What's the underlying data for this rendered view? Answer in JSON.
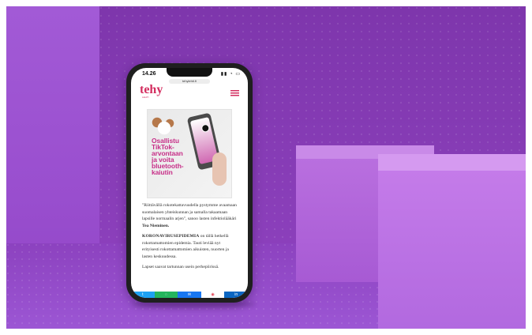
{
  "status_bar": {
    "time": "14.26",
    "url": "tehylehti.fi"
  },
  "site": {
    "logo_main": "tehy",
    "logo_sub": "LEHTI"
  },
  "ad": {
    "line1": "Osallistu",
    "line2": "TikTok-",
    "line3": "arvontaan",
    "line4": "ja voita",
    "line5": "bluetooth-",
    "line6": "kaiutin"
  },
  "article": {
    "paragraph1_text": "\"Riittävällä rokotekattavuudella pystymme avaamaan suomalaisen yhteiskunnan ja samalla takaamaan lapsille normaalin arjen\", sanoo lasten infektiolääkäri",
    "paragraph1_name": "Tea Nieminen.",
    "paragraph2_lead": "KORONAVIRUSEPIDEMIA",
    "paragraph2_text": " on tällä hetkellä rokottamattomien epidemia. Tauti leviää nyt erityisesti rokottamattomien aikuisten, nuorten ja lasten keskuudessa.",
    "paragraph3_text": "Lapset saavat tartunnan usein perhepiirissä."
  },
  "share_bar": {
    "items": [
      {
        "label": "t",
        "icon": "twitter-icon"
      },
      {
        "label": "◌",
        "icon": "whatsapp-icon"
      },
      {
        "label": "✉",
        "icon": "messenger-icon"
      },
      {
        "label": "◉",
        "icon": "pocket-icon"
      },
      {
        "label": "in",
        "icon": "linkedin-icon"
      }
    ]
  }
}
